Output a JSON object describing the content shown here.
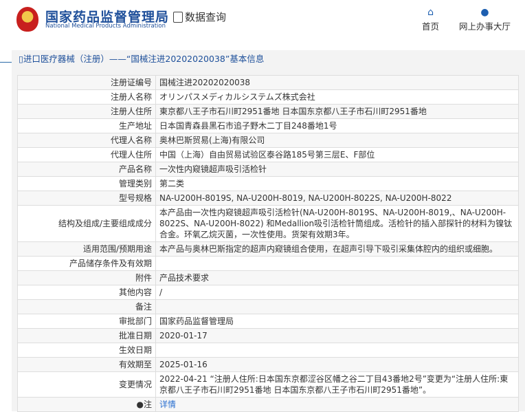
{
  "header": {
    "logo_cn": "国家药品监督管理局",
    "logo_en": "National Medical Products Administration",
    "data_query": "数据查询",
    "nav_home": "首页",
    "nav_online": "网上办事大厅"
  },
  "panel": {
    "title": "进口医疗器械（注册）——“国械注进20202020038”基本信息"
  },
  "rows": [
    {
      "label": "注册证编号",
      "value": "国械注进20202020038"
    },
    {
      "label": "注册人名称",
      "value": "オリンパスメディカルシステムズ株式会社"
    },
    {
      "label": "注册人住所",
      "value": "東京都八王子市石川町2951番地 日本国东京都八王子市石川町2951番地"
    },
    {
      "label": "生产地址",
      "value": "日本国青森县黑石市追子野木二丁目248番地1号"
    },
    {
      "label": "代理人名称",
      "value": "奥林巴斯贸易(上海)有限公司"
    },
    {
      "label": "代理人住所",
      "value": "中国（上海）自由贸易试验区泰谷路185号第三层E、F部位"
    },
    {
      "label": "产品名称",
      "value": "一次性内窥镜超声吸引活检针"
    },
    {
      "label": "管理类别",
      "value": "第二类"
    },
    {
      "label": "型号规格",
      "value": "NA-U200H-8019S, NA-U200H-8019, NA-U200H-8022S, NA-U200H-8022"
    },
    {
      "label": "结构及组成/主要组成成分",
      "value": "本产品由一次性内窥镜超声吸引活检针(NA-U200H-8019S、NA-U200H-8019,、NA-U200H-8022S、NA-U200H-8022) 和Medallion吸引活检针筒组成。活检针的插入部探针的材料为镍钛合金。环氧乙烷灭菌，一次性使用。货架有效期3年。"
    },
    {
      "label": "适用范围/预期用途",
      "value": "本产品与奥林巴斯指定的超声内窥镜组合使用，在超声引导下吸引采集体腔内的组织或细胞。"
    },
    {
      "label": "产品储存条件及有效期",
      "value": ""
    },
    {
      "label": "附件",
      "value": "产品技术要求"
    },
    {
      "label": "其他内容",
      "value": "/"
    },
    {
      "label": "备注",
      "value": ""
    },
    {
      "label": "审批部门",
      "value": "国家药品监督管理局"
    },
    {
      "label": "批准日期",
      "value": "2020-01-17"
    },
    {
      "label": "生效日期",
      "value": ""
    },
    {
      "label": "有效期至",
      "value": "2025-01-16"
    },
    {
      "label": "变更情况",
      "value": "2022-04-21 “注册人住所:日本国东京都涩谷区幡之谷二丁目43番地2号”变更为“注册人住所:東京都八王子市石川町2951番地 日本国东京都八王子市石川町2951番地”。"
    }
  ],
  "note": {
    "label": "注",
    "link": "详情"
  }
}
